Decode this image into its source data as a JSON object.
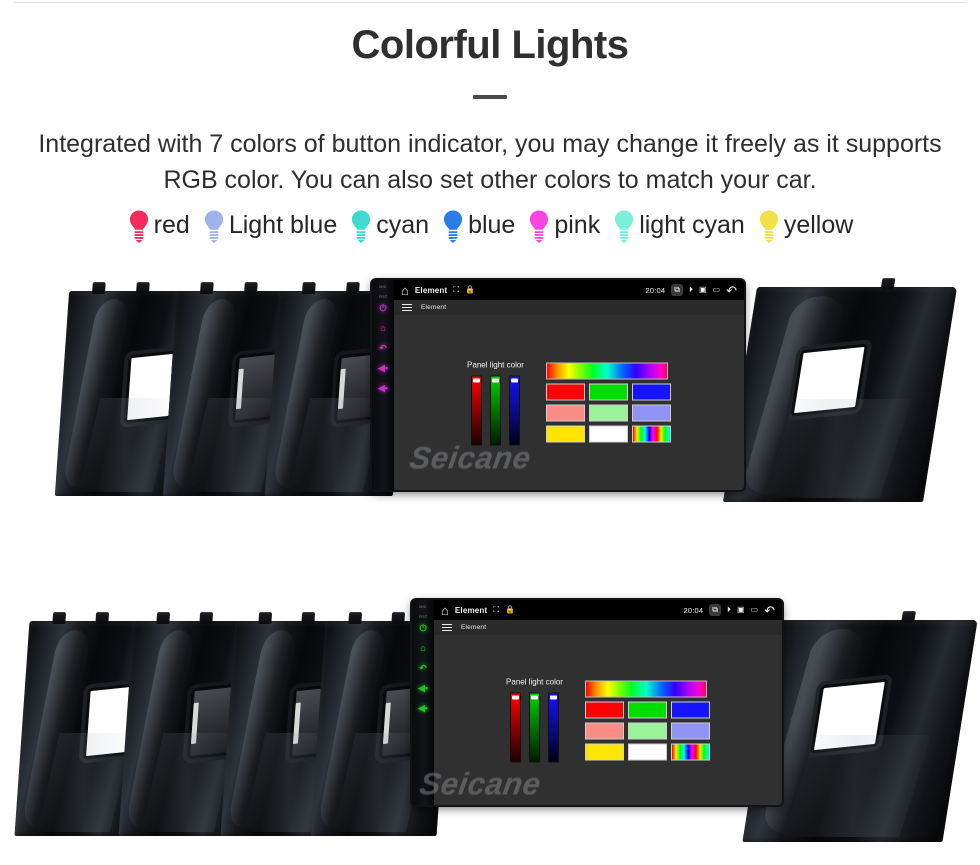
{
  "header": {
    "title": "Colorful Lights",
    "subtitle": "Integrated with 7 colors of button indicator, you may change it freely as it supports RGB color. You can also set other colors to match your car."
  },
  "legend": {
    "items": [
      {
        "label": "red",
        "color": "#f72a5e",
        "icon": "bulb-icon"
      },
      {
        "label": "Light blue",
        "color": "#9fb2ee",
        "icon": "bulb-icon"
      },
      {
        "label": "cyan",
        "color": "#3fd9d1",
        "icon": "bulb-icon"
      },
      {
        "label": "blue",
        "color": "#2a7de8",
        "icon": "bulb-icon"
      },
      {
        "label": "pink",
        "color": "#f845e0",
        "icon": "bulb-icon"
      },
      {
        "label": "light cyan",
        "color": "#7af0d8",
        "icon": "bulb-icon"
      },
      {
        "label": "yellow",
        "color": "#f2e04a",
        "icon": "bulb-icon"
      }
    ]
  },
  "head_unit": {
    "sidebar": {
      "labels": [
        "MIC",
        "RST"
      ],
      "icons": [
        "power-icon",
        "home-icon",
        "back-icon",
        "volume-down-icon",
        "volume-up-icon"
      ]
    },
    "status_bar": {
      "home_icon": "home-icon",
      "title": "Element",
      "mini_icons": [
        "image-icon",
        "lock-icon"
      ],
      "clock": "20:04",
      "right_icons": [
        "screenshot-icon",
        "mute-icon",
        "screen-icon",
        "recents-icon"
      ],
      "back_icon": "back-arrow-icon"
    },
    "app_bar": {
      "menu_icon": "hamburger-icon",
      "title": "Element"
    },
    "panel": {
      "caption": "Panel light color",
      "sliders": [
        {
          "name": "red-slider",
          "color": "#ff0000",
          "value": 100
        },
        {
          "name": "green-slider",
          "color": "#00d000",
          "value": 100
        },
        {
          "name": "blue-slider",
          "color": "#1414ff",
          "value": 100
        }
      ],
      "hue_bar": "rainbow-gradient",
      "swatches": [
        {
          "name": "swatch-red",
          "color": "#ff0000"
        },
        {
          "name": "swatch-green",
          "color": "#00dd00"
        },
        {
          "name": "swatch-blue",
          "color": "#1414ff"
        },
        {
          "name": "swatch-salmon",
          "color": "#fa8c86"
        },
        {
          "name": "swatch-lightgreen",
          "color": "#9af299"
        },
        {
          "name": "swatch-periwinkle",
          "color": "#8f93f5"
        },
        {
          "name": "swatch-yellow",
          "color": "#ffe400"
        },
        {
          "name": "swatch-white",
          "color": "#ffffff"
        },
        {
          "name": "swatch-rainbow",
          "color": "rainbow"
        }
      ]
    }
  },
  "rows": [
    {
      "id": "photo-row-1",
      "watermark": "Seicane",
      "fascia_led_colors": [
        "#3fd9d1",
        "#2a7de8",
        "#c832c8"
      ]
    },
    {
      "id": "photo-row-2",
      "watermark": "Seicane",
      "fascia_led_colors": [
        "#e02020",
        "#ef7014",
        "#e8d219",
        "#22c32a"
      ]
    }
  ]
}
